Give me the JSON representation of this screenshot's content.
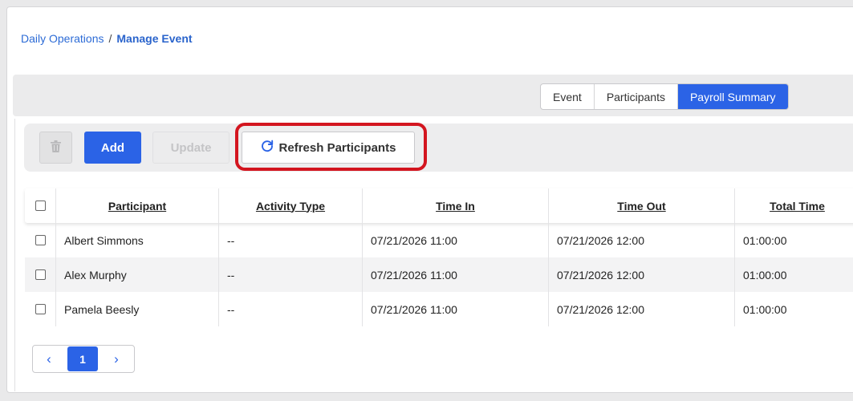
{
  "breadcrumb": {
    "parent": "Daily Operations",
    "separator": "/",
    "current": "Manage Event"
  },
  "tabs": [
    {
      "label": "Event",
      "active": false
    },
    {
      "label": "Participants",
      "active": false
    },
    {
      "label": "Payroll Summary",
      "active": true
    }
  ],
  "toolbar": {
    "delete_icon": "trash-icon",
    "add_label": "Add",
    "update_label": "Update",
    "refresh_label": "Refresh Participants",
    "refresh_icon": "refresh-icon"
  },
  "table": {
    "columns": [
      "Participant",
      "Activity Type",
      "Time In",
      "Time Out",
      "Total Time"
    ],
    "rows": [
      {
        "participant": "Albert Simmons",
        "activity_type": "--",
        "time_in": "07/21/2026 11:00",
        "time_out": "07/21/2026 12:00",
        "total_time": "01:00:00"
      },
      {
        "participant": "Alex Murphy",
        "activity_type": "--",
        "time_in": "07/21/2026 11:00",
        "time_out": "07/21/2026 12:00",
        "total_time": "01:00:00"
      },
      {
        "participant": "Pamela Beesly",
        "activity_type": "--",
        "time_in": "07/21/2026 11:00",
        "time_out": "07/21/2026 12:00",
        "total_time": "01:00:00"
      }
    ]
  },
  "pagination": {
    "prev": "‹",
    "current_page": "1",
    "next": "›"
  },
  "colors": {
    "accent": "#2b63e6",
    "highlight": "#d3151f"
  }
}
